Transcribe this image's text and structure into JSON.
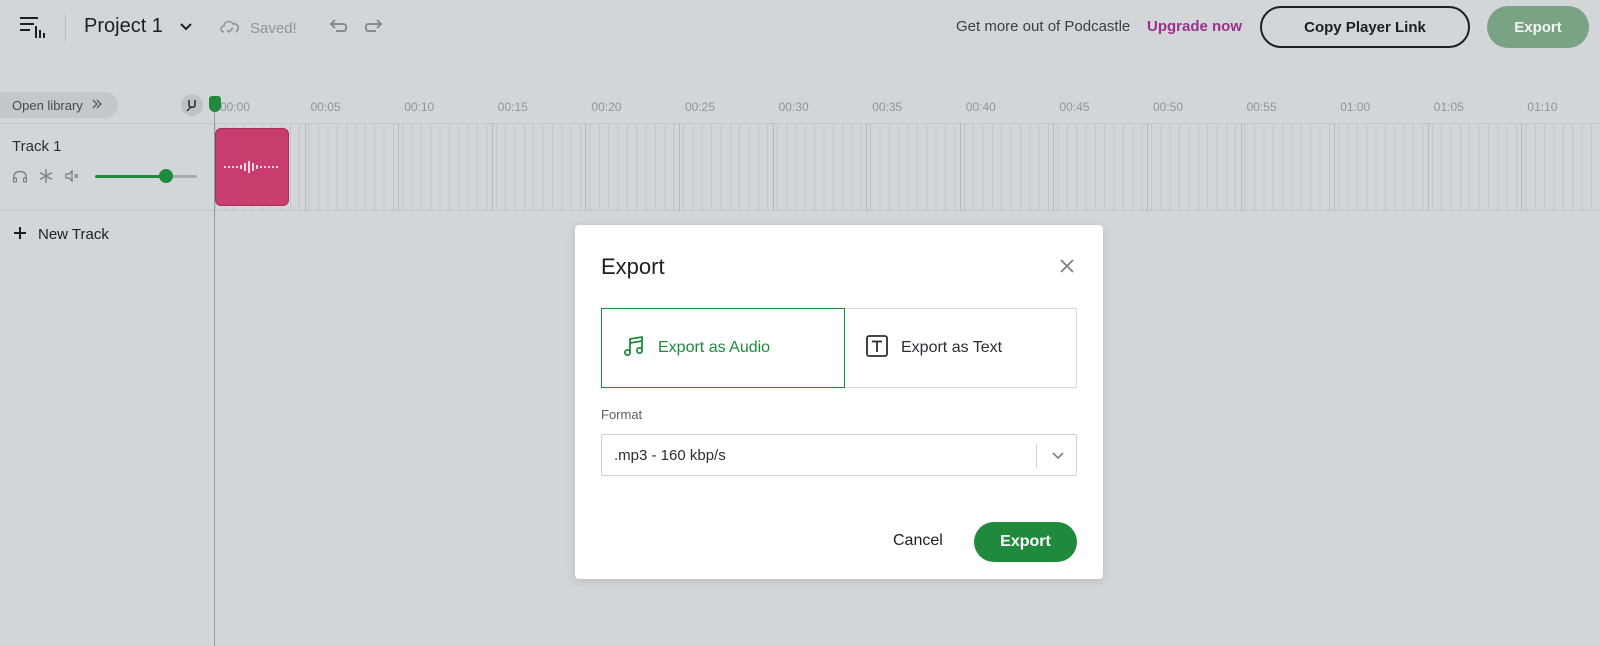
{
  "header": {
    "project_title": "Project 1",
    "saved_status": "Saved!",
    "promo_text": "Get more out of Podcastle",
    "upgrade_label": "Upgrade now",
    "copy_link_label": "Copy Player Link",
    "export_label": "Export"
  },
  "library": {
    "open_label": "Open library"
  },
  "ruler": {
    "ticks": [
      "00:00",
      "00:05",
      "00:10",
      "00:15",
      "00:20",
      "00:25",
      "00:30",
      "00:35",
      "00:40",
      "00:45",
      "00:50",
      "00:55",
      "01:00",
      "01:05",
      "01:10"
    ]
  },
  "tracks": [
    {
      "name": "Track 1",
      "volume": 0.7
    }
  ],
  "new_track_label": "New Track",
  "modal": {
    "title": "Export",
    "tabs": [
      {
        "label": "Export as Audio",
        "icon": "music-note-icon",
        "selected": true
      },
      {
        "label": "Export as Text",
        "icon": "text-t-icon",
        "selected": false
      }
    ],
    "format_label": "Format",
    "format_value": ".mp3 - 160 kbp/s",
    "cancel_label": "Cancel",
    "export_label": "Export"
  },
  "colors": {
    "accent_green": "#1f8a3c",
    "upgrade_purple": "#9b2f8f",
    "clip_pink": "#c93d6e",
    "background": "#d3d6d9"
  }
}
